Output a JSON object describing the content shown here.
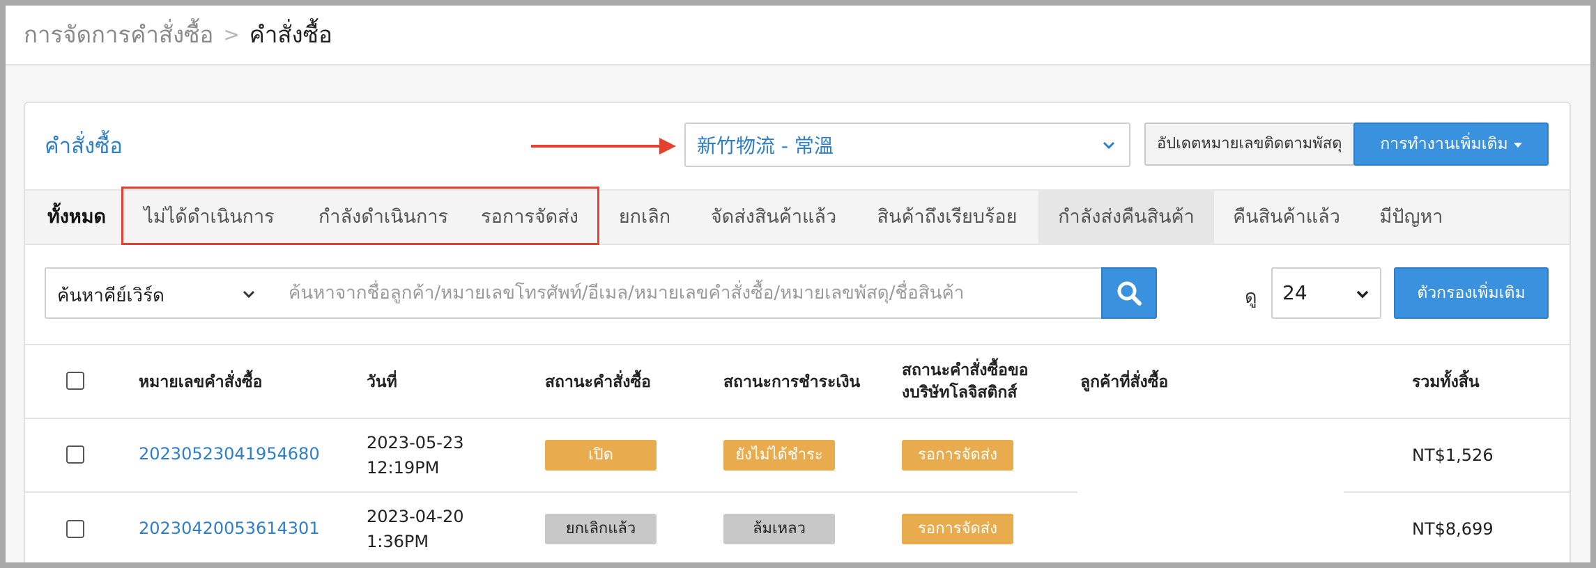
{
  "breadcrumb": {
    "parent": "การจัดการคำสั่งซื้อ",
    "separator": ">",
    "current": "คำสั่งซื้อ"
  },
  "panel": {
    "title": "คำสั่งซื้อ"
  },
  "store_select": {
    "value": "新竹物流 - 常溫"
  },
  "buttons": {
    "update_tracking": "อัปเดตหมายเลขติดตามพัสดุ",
    "more_actions": "การทำงานเพิ่มเติม",
    "more_filters": "ตัวกรองเพิ่มเติม"
  },
  "tabs": [
    {
      "label": "ทั้งหมด"
    },
    {
      "label": "ไม่ได้ดำเนินการ"
    },
    {
      "label": "กำลังดำเนินการ"
    },
    {
      "label": "รอการจัดส่ง"
    },
    {
      "label": "ยกเลิก"
    },
    {
      "label": "จัดส่งสินค้าแล้ว"
    },
    {
      "label": "สินค้าถึงเรียบร้อย"
    },
    {
      "label": "กำลังส่งคืนสินค้า"
    },
    {
      "label": "คืนสินค้าแล้ว"
    },
    {
      "label": "มีปัญหา"
    }
  ],
  "search": {
    "keyword_select": "ค้นหาคีย์เวิร์ด",
    "placeholder": "ค้นหาจากชื่อลูกค้า/หมายเลขโทรศัพท์/อีเมล/หมายเลขคำสั่งซื้อ/หมายเลขพัสดุ/ชื่อสินค้า",
    "value": ""
  },
  "view": {
    "label": "ดู",
    "value": "24"
  },
  "table": {
    "headers": {
      "order_no": "หมายเลขคำสั่งซื้อ",
      "date": "วันที่",
      "order_status": "สถานะคำสั่งซื้อ",
      "payment_status": "สถานะการชำระเงิน",
      "logistics_status_line1": "สถานะคำสั่งซื้อขอ",
      "logistics_status_line2": "งบริษัทโลจิสติกส์",
      "customer": "ลูกค้าที่สั่งซื้อ",
      "total": "รวมทั้งสิ้น"
    },
    "rows": [
      {
        "order_no": "20230523041954680",
        "date": "2023-05-23",
        "time": "12:19PM",
        "order_status": "เปิด",
        "payment_status": "ยังไม่ได้ชำระ",
        "logistics_status": "รอการจัดส่ง",
        "total": "NT$1,526"
      },
      {
        "order_no": "20230420053614301",
        "date": "2023-04-20",
        "time": "1:36PM",
        "order_status": "ยกเลิกแล้ว",
        "payment_status": "ล้มเหลว",
        "logistics_status": "รอการจัดส่ง",
        "total": "NT$8,699"
      }
    ]
  },
  "colors": {
    "accent": "#3a92de",
    "link": "#2f7fc8",
    "badge_orange": "#e8ac4f",
    "badge_grey": "#c8c8c8",
    "annotation_red": "#e2422f"
  }
}
